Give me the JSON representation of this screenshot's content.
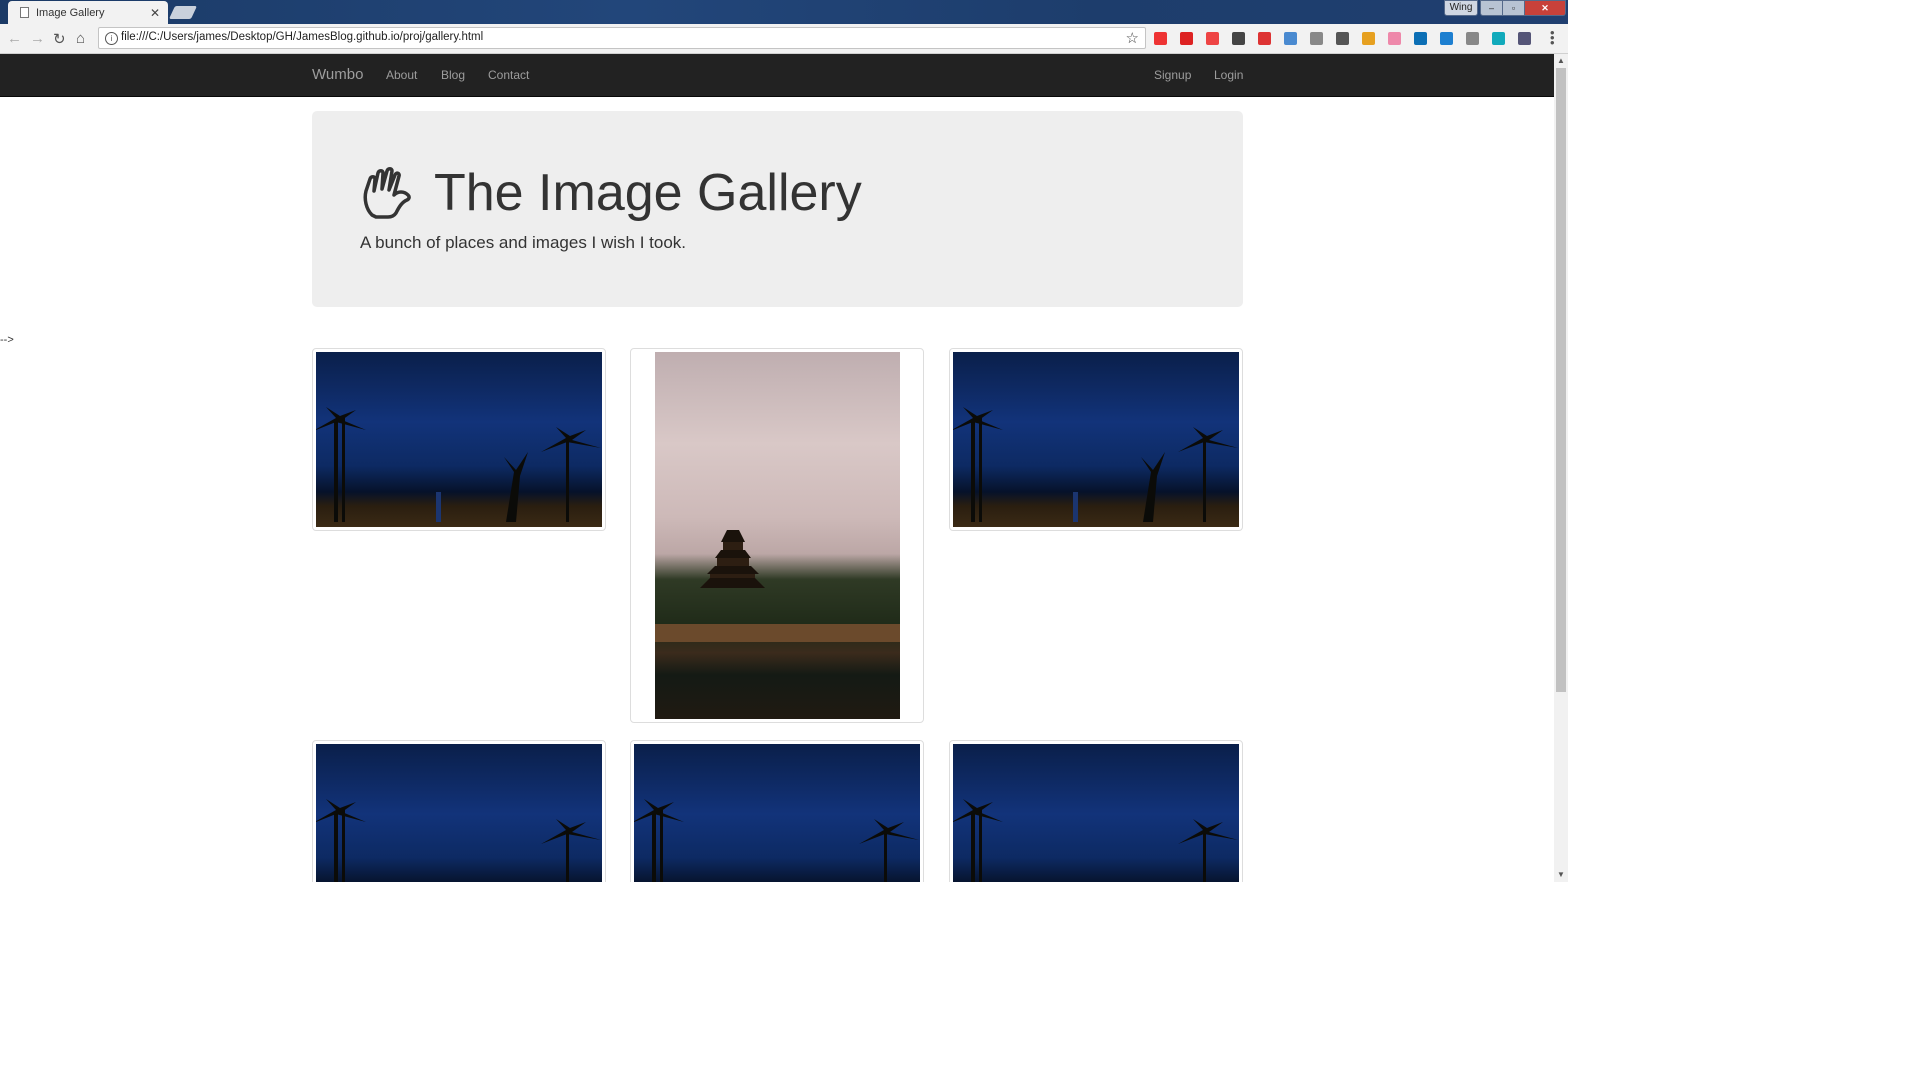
{
  "browser": {
    "tab_title": "Image Gallery",
    "tab_close": "✕",
    "window_user": "Wing",
    "window_buttons": [
      "–",
      "▫",
      "✕"
    ],
    "url": "file:///C:/Users/james/Desktop/GH/JamesBlog.github.io/proj/gallery.html",
    "extension_colors": [
      "#e33",
      "#d22",
      "#e44",
      "#444",
      "#d33",
      "#4a8ad0",
      "#888",
      "#555",
      "#e6a020",
      "#e8a",
      "#0c6fb5",
      "#1d7fd0",
      "#888",
      "#1ab",
      "#557"
    ]
  },
  "navbar": {
    "brand": "Wumbo",
    "left_links": [
      "About",
      "Blog",
      "Contact"
    ],
    "right_links": [
      "Signup",
      "Login"
    ]
  },
  "jumbotron": {
    "title": "The Image Gallery",
    "subtitle": "A bunch of places and images I wish I took.",
    "icon": "hand-icon"
  },
  "stray_text": "-->",
  "gallery": {
    "images": [
      {
        "subject": "night-palm-sky"
      },
      {
        "subject": "castle-pagoda"
      },
      {
        "subject": "night-palm-sky"
      },
      {
        "subject": "night-palm-sky"
      },
      {
        "subject": "night-palm-sky"
      },
      {
        "subject": "night-palm-sky"
      }
    ]
  }
}
